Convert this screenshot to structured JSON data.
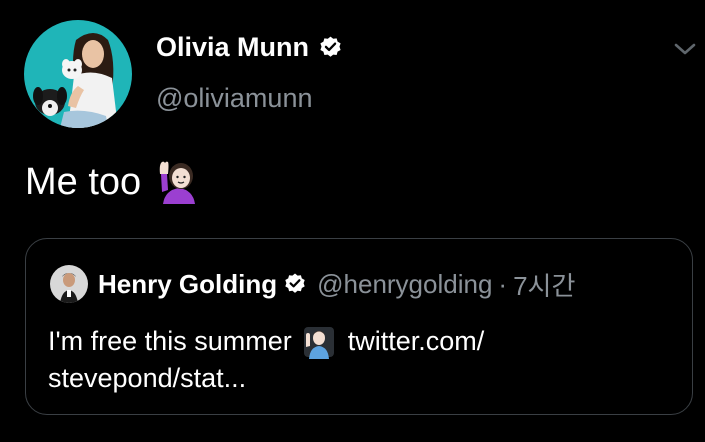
{
  "tweet": {
    "author_name": "Olivia Munn",
    "author_handle": "@oliviamunn",
    "text": "Me too",
    "text_emoji": "person-raising-hand-icon"
  },
  "quoted_tweet": {
    "author_name": "Henry Golding",
    "author_handle": "@henrygolding",
    "separator": "·",
    "time": "7시간",
    "text_before_emoji": "I'm free this summer",
    "text_emoji": "person-raising-hand-icon",
    "text_link_line1": "twitter.com/",
    "text_link_line2": "stevepond/stat..."
  },
  "colors": {
    "background": "#000000",
    "text_primary": "#ffffff",
    "text_secondary": "#8b9299",
    "card_border": "#3a3f44",
    "avatar_bg": "#1fb5b8"
  }
}
